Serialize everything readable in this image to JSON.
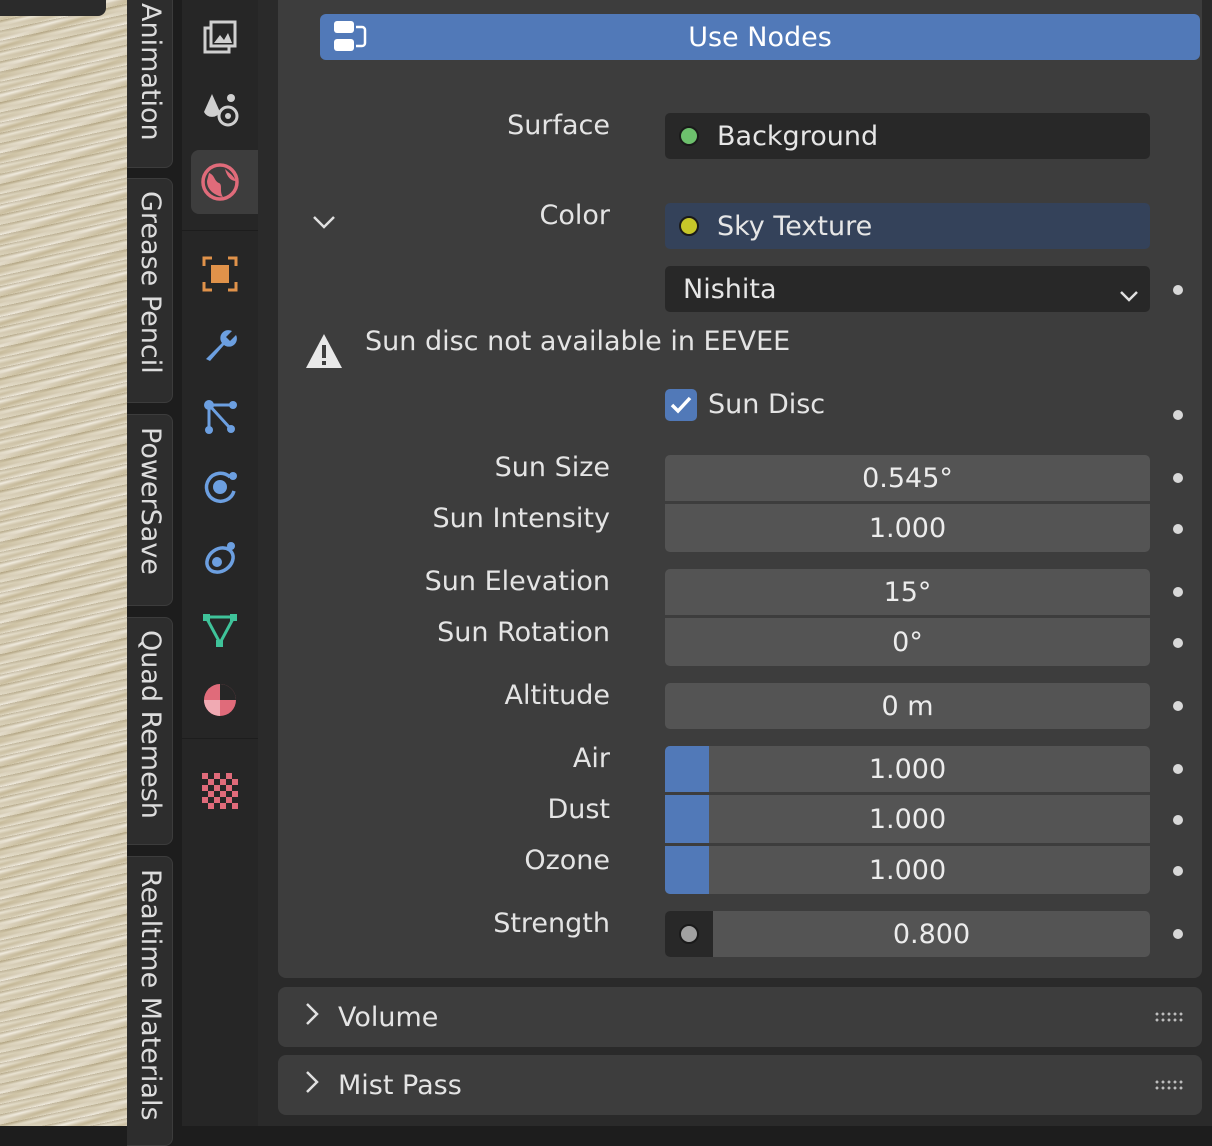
{
  "sidebar_tabs": [
    "Animation",
    "Grease Pencil",
    "PowerSave",
    "Quad Remesh",
    "Realtime Materials"
  ],
  "property_icons": [
    "render-icon",
    "scene-icon",
    "world-icon",
    "object-icon",
    "modifier-icon",
    "particles-icon",
    "physics-icon",
    "constraints-icon",
    "data-icon",
    "material-icon",
    "texture-icon"
  ],
  "use_nodes": {
    "label": "Use Nodes"
  },
  "surface": {
    "label": "Surface",
    "value": "Background",
    "socket_color": "#6dc06d"
  },
  "color": {
    "label": "Color",
    "value": "Sky Texture",
    "socket_color": "#c7c729"
  },
  "sky_type": {
    "value": "Nishita"
  },
  "warning": {
    "text": "Sun disc not available in EEVEE"
  },
  "sun_disc": {
    "label": "Sun Disc",
    "checked": true
  },
  "fields": {
    "sun_size": {
      "label": "Sun Size",
      "value": "0.545°"
    },
    "sun_intensity": {
      "label": "Sun Intensity",
      "value": "1.000"
    },
    "sun_elevation": {
      "label": "Sun Elevation",
      "value": "15°"
    },
    "sun_rotation": {
      "label": "Sun Rotation",
      "value": "0°"
    },
    "altitude": {
      "label": "Altitude",
      "value": "0 m"
    },
    "air": {
      "label": "Air",
      "value": "1.000"
    },
    "dust": {
      "label": "Dust",
      "value": "1.000"
    },
    "ozone": {
      "label": "Ozone",
      "value": "1.000"
    },
    "strength": {
      "label": "Strength",
      "value": "0.800",
      "socket_color": "#a1a1a1"
    }
  },
  "panels": {
    "volume": "Volume",
    "mist_pass": "Mist Pass"
  },
  "colors": {
    "accent": "#5179b8",
    "panel": "#3d3d3d",
    "field": "#545454"
  }
}
